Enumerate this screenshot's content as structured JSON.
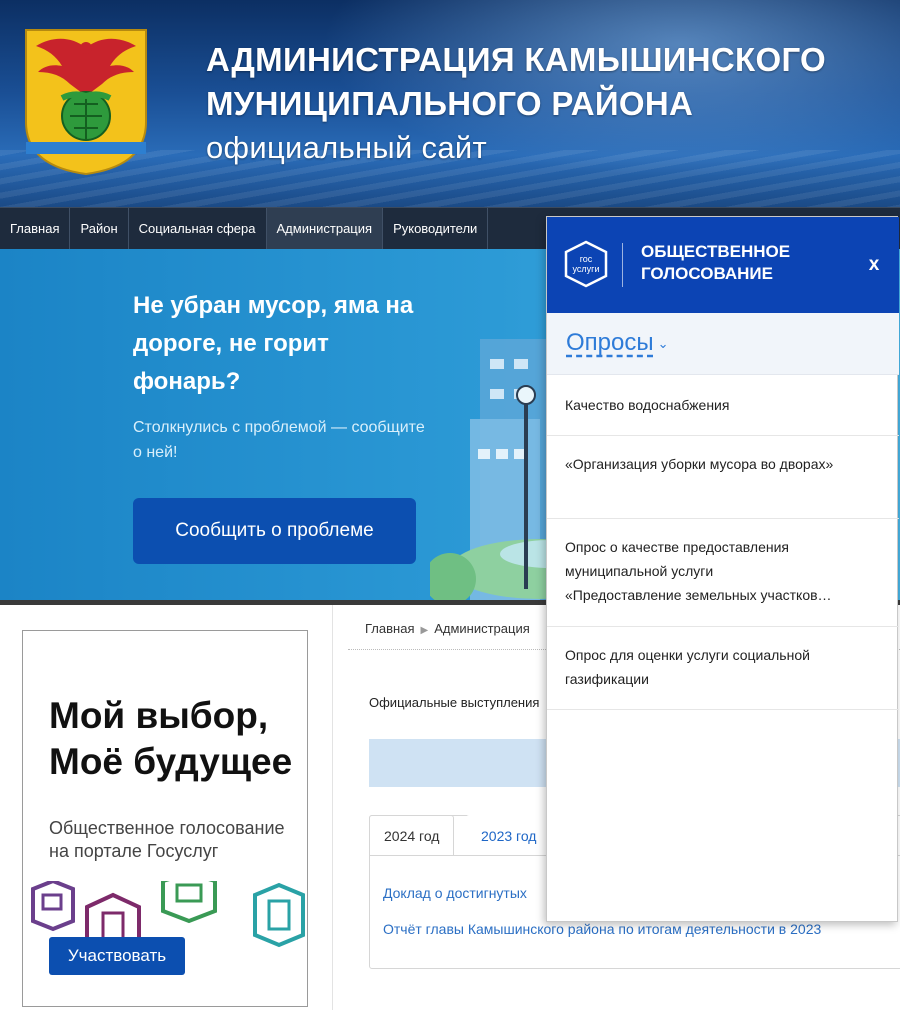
{
  "header": {
    "title_line1": "АДМИНИСТРАЦИЯ  КАМЫШИНСКОГО",
    "title_line2": "МУНИЦИПАЛЬНОГО  РАЙОНА",
    "title_line3": "официальный сайт"
  },
  "nav": {
    "items": [
      {
        "label": "Главная"
      },
      {
        "label": "Район"
      },
      {
        "label": "Социальная сфера"
      },
      {
        "label": "Администрация"
      },
      {
        "label": "Руководители"
      }
    ]
  },
  "banner": {
    "heading": "Не убран мусор, яма на дороге, не горит фонарь?",
    "subtitle": "Столкнулись с проблемой — сообщите о ней!",
    "button_label": "Сообщить о проблеме"
  },
  "promo": {
    "title_line1": "Мой выбор,",
    "title_line2": "Моё будущее",
    "text": "Общественное голосование на портале Госуслуг",
    "button_label": "Участвовать"
  },
  "breadcrumb": {
    "home": "Главная",
    "current": "Администрация"
  },
  "main": {
    "section_label": "Официальные выступления",
    "tabs": [
      {
        "label": "2024 год"
      },
      {
        "label": "2023 год"
      }
    ],
    "documents": [
      "Доклад о достигнутых",
      "Отчёт главы Камышинского района по итогам деятельности в 2023"
    ]
  },
  "widget": {
    "logo_text_line1": "гос",
    "logo_text_line2": "услуги",
    "title": "ОБЩЕСТВЕННОЕ ГОЛОСОВАНИЕ",
    "close_label": "x",
    "surveys_label": "Опросы",
    "items": [
      {
        "label": "Качество водоснабжения"
      },
      {
        "label": "«Организация уборки мусора во дворах»"
      },
      {
        "label_line1": "Опрос о качестве предоставления муниципальной услуги",
        "label_line2": "«Предоставление земельных участков…"
      },
      {
        "label": "Опрос для оценки услуги социальной газификации"
      }
    ]
  },
  "colors": {
    "header_blue": "#1a4f95",
    "nav_dark": "#1e2b3d",
    "banner_blue": "#2c9ad6",
    "gosuslugi_blue": "#0c44b4",
    "link_blue": "#2e7bd8"
  }
}
